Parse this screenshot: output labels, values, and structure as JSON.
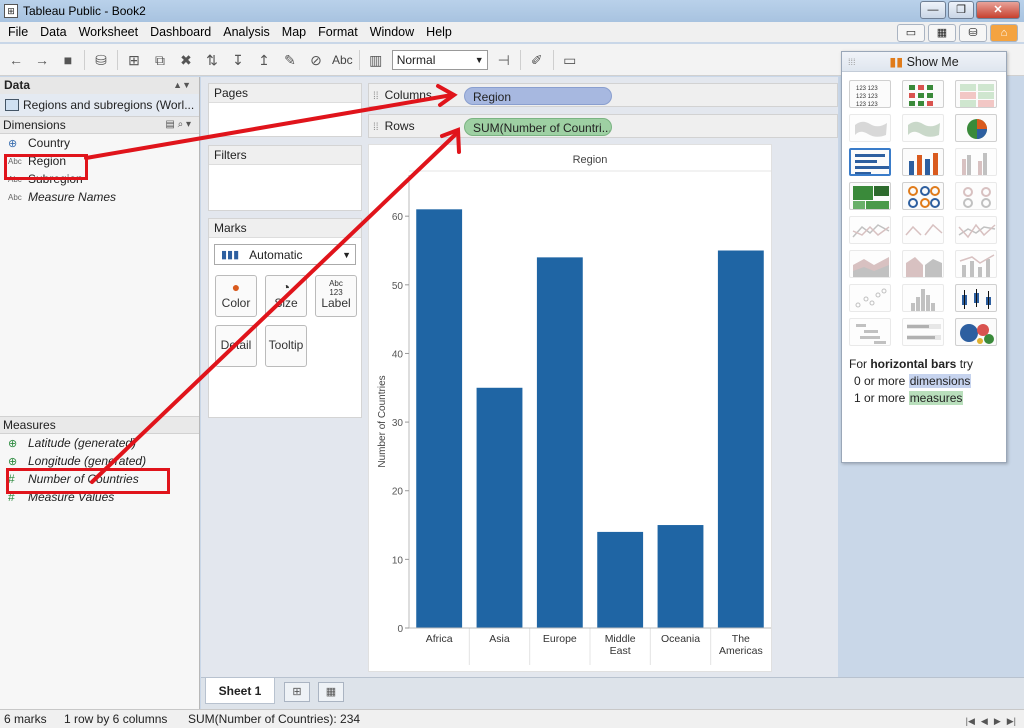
{
  "window": {
    "title": "Tableau Public - Book2",
    "min": "—",
    "max": "❐",
    "close": "✕"
  },
  "menu": [
    "File",
    "Data",
    "Worksheet",
    "Dashboard",
    "Analysis",
    "Map",
    "Format",
    "Window",
    "Help"
  ],
  "toolbar": {
    "abc_label": "Abc",
    "view_size": "Normal"
  },
  "data_pane": {
    "header": "Data",
    "datasource": "Regions and subregions (Worl...",
    "dimensions_header": "Dimensions",
    "dimensions": [
      {
        "label": "Country",
        "type": "globe"
      },
      {
        "label": "Region",
        "type": "Abc"
      },
      {
        "label": "Subregion",
        "type": "Abc"
      },
      {
        "label": "Measure Names",
        "type": "Abc"
      }
    ],
    "measures_header": "Measures",
    "measures": [
      {
        "label": "Latitude (generated)",
        "type": "globe"
      },
      {
        "label": "Longitude (generated)",
        "type": "globe"
      },
      {
        "label": "Number of Countries",
        "type": "#"
      },
      {
        "label": "Measure Values",
        "type": "#"
      }
    ]
  },
  "cards": {
    "pages": "Pages",
    "filters": "Filters",
    "marks": "Marks",
    "mark_type": "Automatic",
    "mark_buttons": {
      "color": "Color",
      "size": "Size",
      "label": "Label",
      "detail": "Detail",
      "tooltip": "Tooltip",
      "label_icon": "Abc\n123"
    }
  },
  "shelves": {
    "columns_label": "Columns",
    "columns_pill": "Region",
    "rows_label": "Rows",
    "rows_pill": "SUM(Number of Countri..."
  },
  "chart_data": {
    "type": "bar",
    "header": "Region",
    "categories": [
      "Africa",
      "Asia",
      "Europe",
      "Middle\nEast",
      "Oceania",
      "The\nAmericas"
    ],
    "values": [
      61,
      35,
      54,
      14,
      15,
      55
    ],
    "ylabel": "Number of Countries",
    "ylim": [
      0,
      66
    ],
    "yticks": [
      0,
      10,
      20,
      30,
      40,
      50,
      60
    ],
    "bar_color": "#1f65a4"
  },
  "show_me": {
    "title": "Show Me",
    "hint_prefix": "For ",
    "hint_bold": "horizontal bars",
    "hint_suffix": " try",
    "line1_prefix": "0 or more ",
    "line1_hl": "dimensions",
    "line2_prefix": "1 or more ",
    "line2_hl": "measures"
  },
  "sheet_tabs": {
    "active": "Sheet 1"
  },
  "status": {
    "marks": "6 marks",
    "rows_cols": "1 row by 6 columns",
    "sum": "SUM(Number of Countries): 234"
  },
  "colors": {
    "highlight_red": "#e0141b",
    "dimension_pill": "#a7b8e0",
    "measure_pill": "#9ed0a3"
  }
}
